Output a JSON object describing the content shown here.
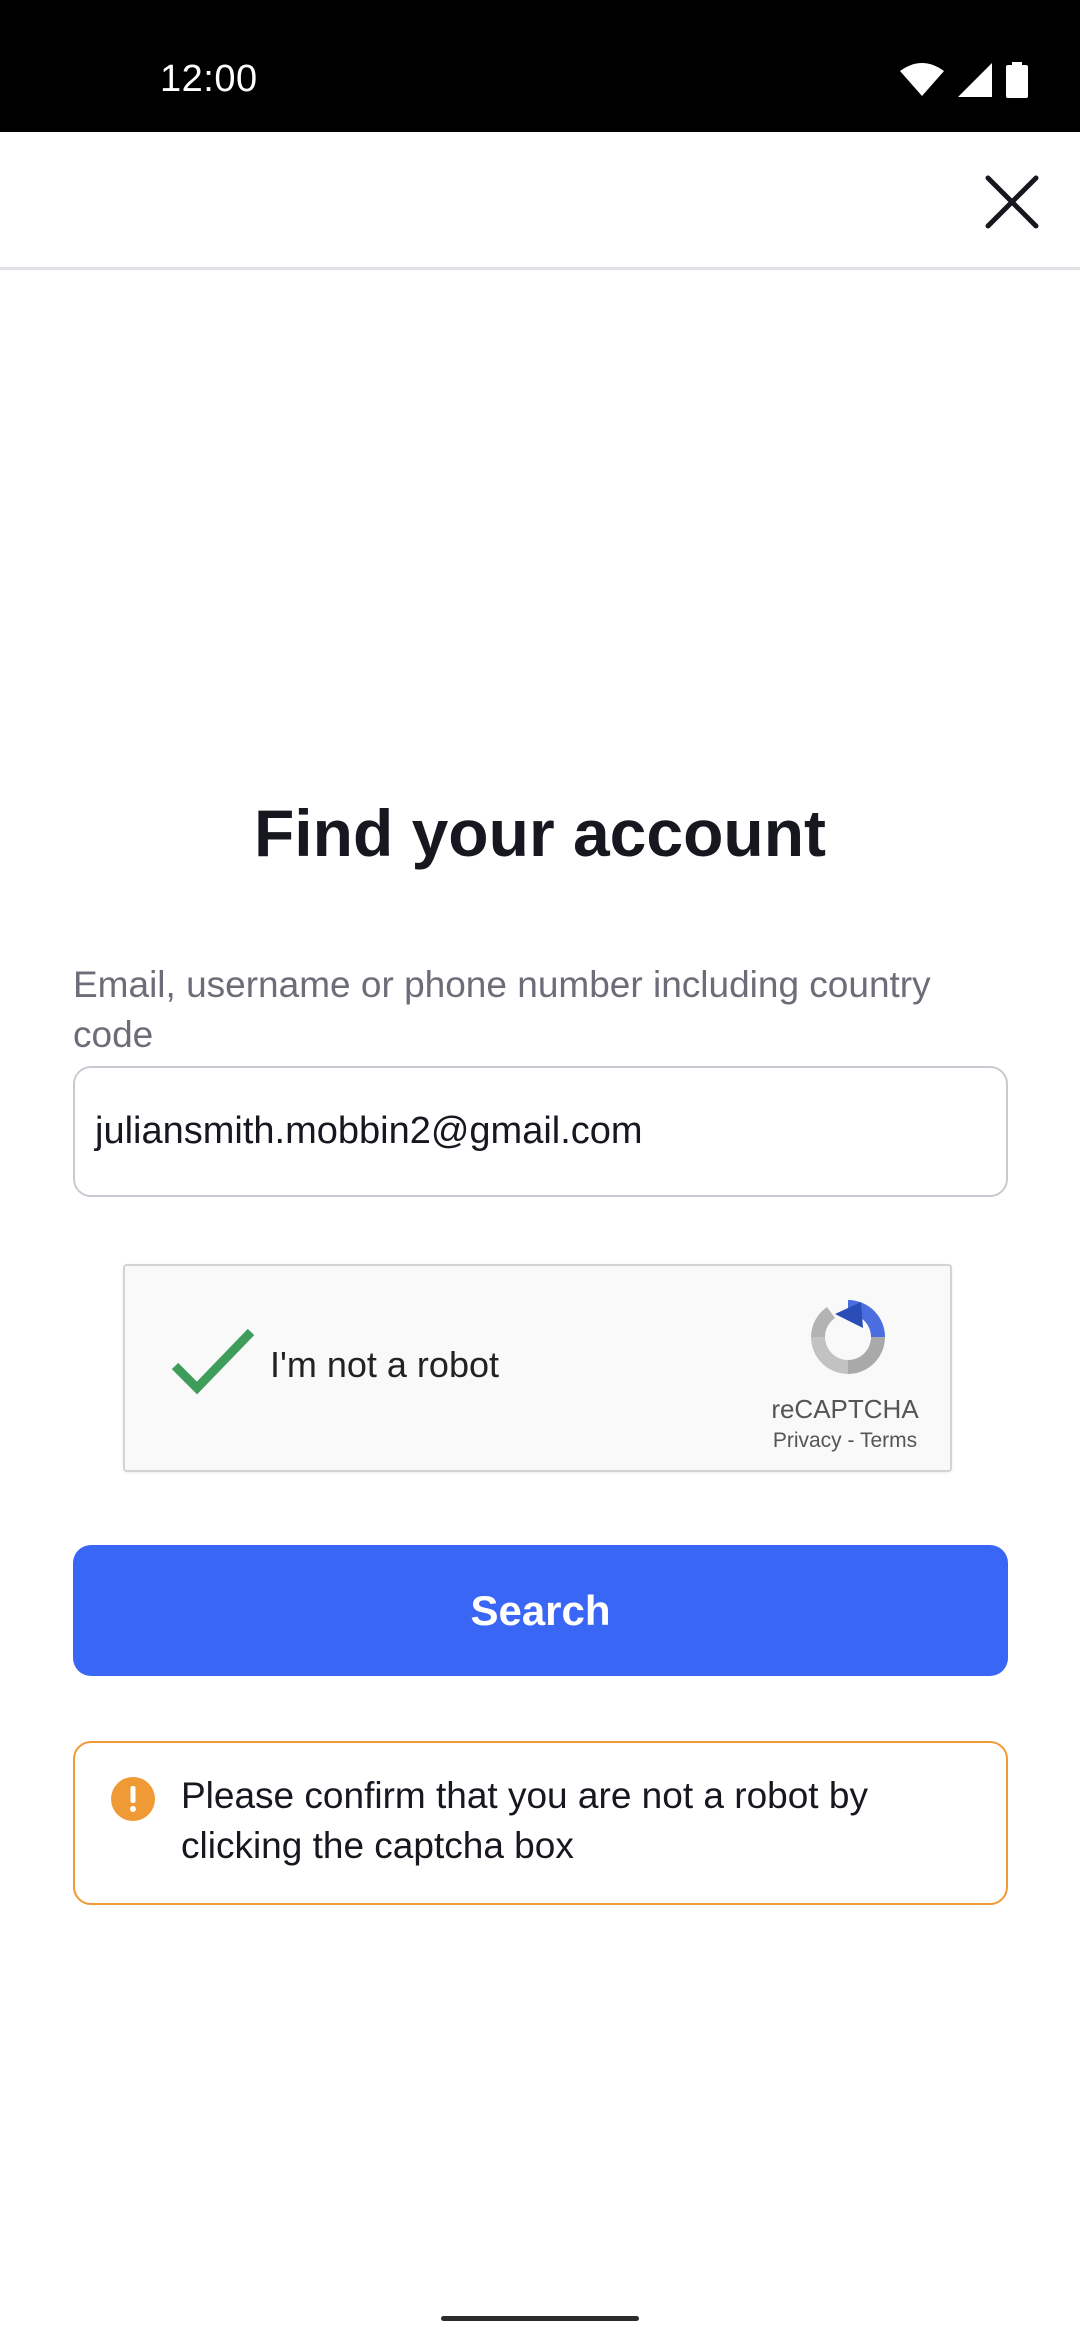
{
  "status_bar": {
    "time": "12:00"
  },
  "page": {
    "title": "Find your account"
  },
  "form": {
    "field_label": "Email, username or phone number including country code",
    "field_value": "juliansmith.mobbin2@gmail.com"
  },
  "captcha": {
    "label": "I'm not a robot",
    "brand": "reCAPTCHA",
    "privacy_link": "Privacy",
    "separator": "-",
    "terms_link": "Terms"
  },
  "search_button": {
    "label": "Search"
  },
  "alert": {
    "message": "Please confirm that you are not a robot by clicking the captcha box"
  },
  "colors": {
    "primary": "#3a66f5",
    "warning": "#f09a35",
    "check_green": "#3f9d5c"
  }
}
